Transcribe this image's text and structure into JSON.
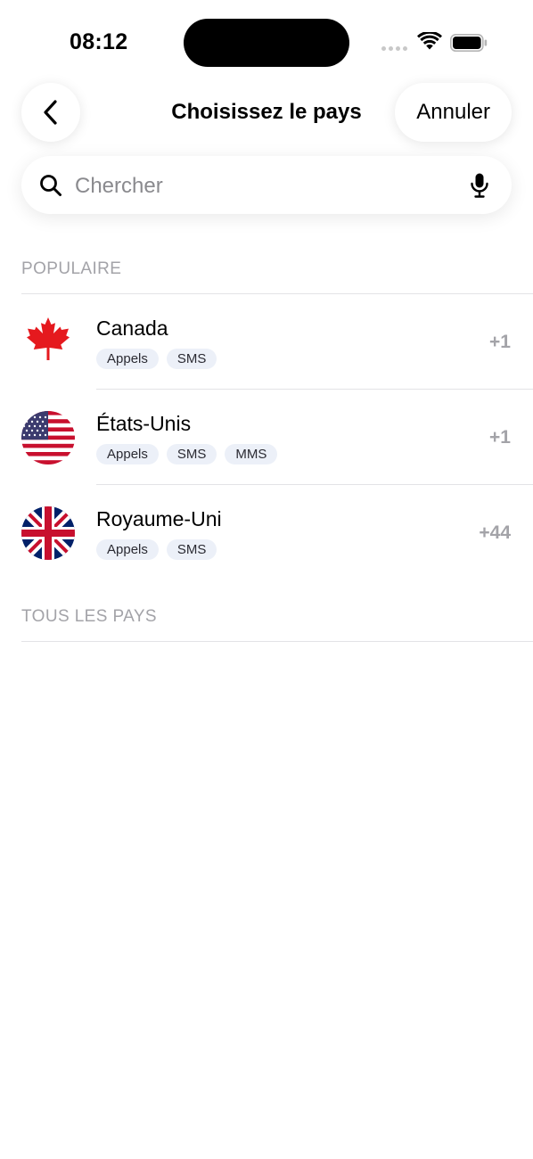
{
  "status_bar": {
    "time": "08:12",
    "signal_icon": "signal-dots-icon",
    "wifi_icon": "wifi-icon",
    "battery_icon": "battery-full-icon"
  },
  "header": {
    "back_icon": "chevron-left-icon",
    "title": "Choisissez le pays",
    "cancel_label": "Annuler"
  },
  "search": {
    "placeholder": "Chercher",
    "value": "",
    "search_icon": "magnifier-icon",
    "mic_icon": "microphone-icon"
  },
  "sections": {
    "popular_title": "POPULAIRE",
    "all_title": "TOUS LES PAYS"
  },
  "popular_countries": [
    {
      "name": "Canada",
      "dial_code": "+1",
      "flag_icon": "canada-flag-icon",
      "services": [
        "Appels",
        "SMS"
      ]
    },
    {
      "name": "États-Unis",
      "dial_code": "+1",
      "flag_icon": "usa-flag-icon",
      "services": [
        "Appels",
        "SMS",
        "MMS"
      ]
    },
    {
      "name": "Royaume-Uni",
      "dial_code": "+44",
      "flag_icon": "uk-flag-icon",
      "services": [
        "Appels",
        "SMS"
      ]
    }
  ],
  "colors": {
    "background": "#ffffff",
    "section_header": "#a3a3a8",
    "divider": "#e3e3e6",
    "badge_bg": "#ecf0f8",
    "dial_code": "#a3a3a8"
  }
}
